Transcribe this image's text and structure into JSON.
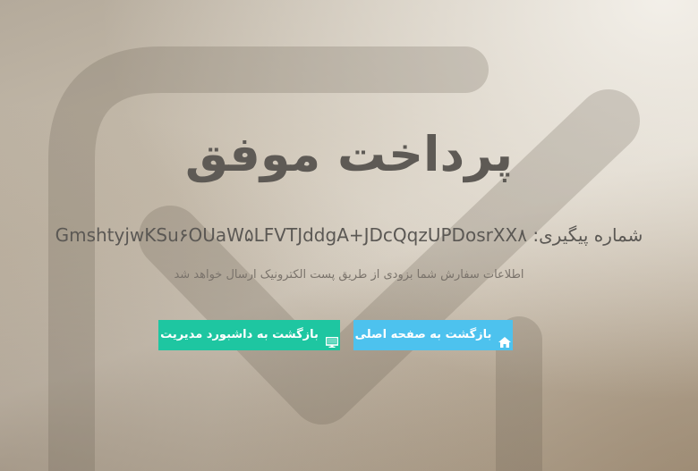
{
  "page": {
    "title": "پرداخت موفق",
    "tracking_label": "شماره پیگیری:",
    "tracking_code": "GmshtyjwKSu۶OUaW۵LFVTJddgA+JDcQqzUPDosrXX۸",
    "info_text": "اطلاعات سفارش شما بزودی از طریق پست الکترونیک ارسال خواهد شد"
  },
  "buttons": {
    "home_label": "بازگشت به صفحه اصلی",
    "home_icon": "home-icon",
    "home_color": "#4dc2ee",
    "dashboard_label": "بازگشت به داشبورد مدیریت",
    "dashboard_icon": "desktop-icon",
    "dashboard_color": "#1ec6a1"
  },
  "background": {
    "icon": "checkbox-check-icon"
  }
}
